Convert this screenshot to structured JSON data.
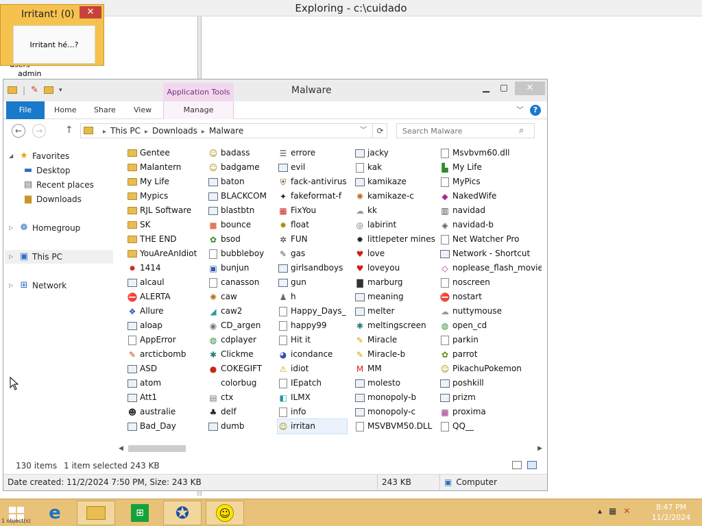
{
  "background_window": {
    "title": "Exploring - c:\\cuidado",
    "tree": [
      "users",
      "admin"
    ]
  },
  "irritant_popup": {
    "title": "Irritant! (0)",
    "close": "✕",
    "message": "Irritant hé...?"
  },
  "explorer": {
    "title": "Malware",
    "contextual_tab_group": "Application Tools",
    "ribbon_tabs": {
      "file": "File",
      "home": "Home",
      "share": "Share",
      "view": "View",
      "manage": "Manage"
    },
    "breadcrumb": [
      "This PC",
      "Downloads",
      "Malware"
    ],
    "search_placeholder": "Search Malware",
    "nav": {
      "favorites": "Favorites",
      "desktop": "Desktop",
      "recent": "Recent places",
      "downloads": "Downloads",
      "homegroup": "Homegroup",
      "this_pc": "This PC",
      "network": "Network"
    },
    "columns": [
      [
        {
          "name": "Gentee",
          "icon": "folder"
        },
        {
          "name": "Malantern",
          "icon": "folder"
        },
        {
          "name": "My Life",
          "icon": "folder"
        },
        {
          "name": "Mypics",
          "icon": "folder"
        },
        {
          "name": "RJL Software",
          "icon": "folder"
        },
        {
          "name": "SK",
          "icon": "folder"
        },
        {
          "name": "THE END",
          "icon": "folder"
        },
        {
          "name": "YouAreAnIdiot",
          "icon": "folder"
        },
        {
          "name": "1414",
          "icon": "glyph",
          "glyph": "✸",
          "color": "#c0261e"
        },
        {
          "name": "alcaul",
          "icon": "exe"
        },
        {
          "name": "ALERTA",
          "icon": "glyph",
          "glyph": "⛔",
          "color": "#d01b1b"
        },
        {
          "name": "Allure",
          "icon": "glyph",
          "glyph": "❖",
          "color": "#2b55b5"
        },
        {
          "name": "aloap",
          "icon": "exe"
        },
        {
          "name": "AppError",
          "icon": "doc"
        },
        {
          "name": "arcticbomb",
          "icon": "glyph",
          "glyph": "✎",
          "color": "#c4481a"
        },
        {
          "name": "ASD",
          "icon": "exe"
        },
        {
          "name": "atom",
          "icon": "exe"
        },
        {
          "name": "Att1",
          "icon": "exe"
        },
        {
          "name": "australie",
          "icon": "glyph",
          "glyph": "☻",
          "color": "#333"
        },
        {
          "name": "Bad_Day",
          "icon": "exe"
        }
      ],
      [
        {
          "name": "badass",
          "icon": "glyph",
          "glyph": "☺",
          "color": "#a88a00"
        },
        {
          "name": "badgame",
          "icon": "glyph",
          "glyph": "☺",
          "color": "#a88a00"
        },
        {
          "name": "baton",
          "icon": "exe"
        },
        {
          "name": "BLACKCOM",
          "icon": "exe"
        },
        {
          "name": "blastbtn",
          "icon": "exe"
        },
        {
          "name": "bounce",
          "icon": "glyph",
          "glyph": "■",
          "color": "#e47a5a"
        },
        {
          "name": "bsod",
          "icon": "glyph",
          "glyph": "✿",
          "color": "#2f8a2f"
        },
        {
          "name": "bubbleboy",
          "icon": "doc"
        },
        {
          "name": "bunjun",
          "icon": "glyph",
          "glyph": "▣",
          "color": "#3554a8"
        },
        {
          "name": "canasson",
          "icon": "doc"
        },
        {
          "name": "caw",
          "icon": "glyph",
          "glyph": "✺",
          "color": "#b86f1a"
        },
        {
          "name": "caw2",
          "icon": "glyph",
          "glyph": "◢",
          "color": "#2a9aa5"
        },
        {
          "name": "CD_argen",
          "icon": "glyph",
          "glyph": "◉",
          "color": "#777"
        },
        {
          "name": "cdplayer",
          "icon": "glyph",
          "glyph": "◍",
          "color": "#2f8a2f"
        },
        {
          "name": "Clickme",
          "icon": "glyph",
          "glyph": "✱",
          "color": "#2a7a7a"
        },
        {
          "name": "COKEGIFT",
          "icon": "glyph",
          "glyph": "●",
          "color": "#c4261e"
        },
        {
          "name": "colorbug",
          "icon": "none"
        },
        {
          "name": "ctx",
          "icon": "glyph",
          "glyph": "▤",
          "color": "#777"
        },
        {
          "name": "delf",
          "icon": "glyph",
          "glyph": "♣",
          "color": "#222"
        },
        {
          "name": "dumb",
          "icon": "exe"
        }
      ],
      [
        {
          "name": "errore",
          "icon": "glyph",
          "glyph": "☰",
          "color": "#555"
        },
        {
          "name": "evil",
          "icon": "exe"
        },
        {
          "name": "fack-antivirus",
          "icon": "glyph",
          "glyph": "⛨",
          "color": "#6b4a1a"
        },
        {
          "name": "fakeformat-f",
          "icon": "glyph",
          "glyph": "✦",
          "color": "#222"
        },
        {
          "name": "FixYou",
          "icon": "glyph",
          "glyph": "▦",
          "color": "#c4261e"
        },
        {
          "name": "float",
          "icon": "glyph",
          "glyph": "✹",
          "color": "#a88a00"
        },
        {
          "name": "FUN",
          "icon": "glyph",
          "glyph": "✲",
          "color": "#333"
        },
        {
          "name": "gas",
          "icon": "glyph",
          "glyph": "✎",
          "color": "#555"
        },
        {
          "name": "girlsandboys",
          "icon": "exe"
        },
        {
          "name": "gun",
          "icon": "exe"
        },
        {
          "name": "h",
          "icon": "glyph",
          "glyph": "♟",
          "color": "#666"
        },
        {
          "name": "Happy_Days_",
          "icon": "doc"
        },
        {
          "name": "happy99",
          "icon": "doc"
        },
        {
          "name": "Hit it",
          "icon": "doc"
        },
        {
          "name": "icondance",
          "icon": "glyph",
          "glyph": "◕",
          "color": "#3554a8"
        },
        {
          "name": "idiot",
          "icon": "glyph",
          "glyph": "⚠",
          "color": "#c9a400"
        },
        {
          "name": "IEpatch",
          "icon": "doc"
        },
        {
          "name": "ILMX",
          "icon": "glyph",
          "glyph": "◧",
          "color": "#2a9aa5"
        },
        {
          "name": "info",
          "icon": "doc"
        },
        {
          "name": "irritan",
          "icon": "glyph",
          "glyph": "☺",
          "color": "#a88a00",
          "selected": true
        }
      ],
      [
        {
          "name": "jacky",
          "icon": "exe"
        },
        {
          "name": "kak",
          "icon": "doc"
        },
        {
          "name": "kamikaze",
          "icon": "exe"
        },
        {
          "name": "kamikaze-c",
          "icon": "glyph",
          "glyph": "✺",
          "color": "#b86f1a"
        },
        {
          "name": "kk",
          "icon": "glyph",
          "glyph": "☁",
          "color": "#999"
        },
        {
          "name": "labirint",
          "icon": "glyph",
          "glyph": "◎",
          "color": "#666"
        },
        {
          "name": "littlepeter mines",
          "icon": "glyph",
          "glyph": "✸",
          "color": "#222"
        },
        {
          "name": "love",
          "icon": "glyph",
          "glyph": "♥",
          "color": "#d01b1b"
        },
        {
          "name": "loveyou",
          "icon": "glyph",
          "glyph": "♥",
          "color": "#d01b1b"
        },
        {
          "name": "marburg",
          "icon": "glyph",
          "glyph": "▇",
          "color": "#333"
        },
        {
          "name": "meaning",
          "icon": "exe"
        },
        {
          "name": "melter",
          "icon": "exe"
        },
        {
          "name": "meltingscreen",
          "icon": "glyph",
          "glyph": "✱",
          "color": "#2a7a7a"
        },
        {
          "name": "Miracle",
          "icon": "glyph",
          "glyph": "✎",
          "color": "#c9a400"
        },
        {
          "name": "Miracle-b",
          "icon": "glyph",
          "glyph": "✎",
          "color": "#c9a400"
        },
        {
          "name": "MM",
          "icon": "glyph",
          "glyph": "M",
          "color": "#d41b1b"
        },
        {
          "name": "molesto",
          "icon": "exe"
        },
        {
          "name": "monopoly-b",
          "icon": "exe"
        },
        {
          "name": "monopoly-c",
          "icon": "exe"
        },
        {
          "name": "MSVBVM50.DLL",
          "icon": "doc"
        }
      ],
      [
        {
          "name": "Msvbvm60.dll",
          "icon": "doc"
        },
        {
          "name": "My Life",
          "icon": "glyph",
          "glyph": "▙",
          "color": "#2f8a2f"
        },
        {
          "name": "MyPics",
          "icon": "doc"
        },
        {
          "name": "NakedWife",
          "icon": "glyph",
          "glyph": "◆",
          "color": "#a0308a"
        },
        {
          "name": "navidad",
          "icon": "glyph",
          "glyph": "▥",
          "color": "#444"
        },
        {
          "name": "navidad-b",
          "icon": "glyph",
          "glyph": "◈",
          "color": "#555"
        },
        {
          "name": "Net Watcher Pro",
          "icon": "doc"
        },
        {
          "name": "Network - Shortcut",
          "icon": "exe"
        },
        {
          "name": "noplease_flash_movie",
          "icon": "glyph",
          "glyph": "◇",
          "color": "#a0308a"
        },
        {
          "name": "noscreen",
          "icon": "doc"
        },
        {
          "name": "nostart",
          "icon": "glyph",
          "glyph": "⛔",
          "color": "#d01b1b"
        },
        {
          "name": "nuttymouse",
          "icon": "glyph",
          "glyph": "☁",
          "color": "#999"
        },
        {
          "name": "open_cd",
          "icon": "glyph",
          "glyph": "◍",
          "color": "#2f8a2f"
        },
        {
          "name": "parkin",
          "icon": "doc"
        },
        {
          "name": "parrot",
          "icon": "glyph",
          "glyph": "✿",
          "color": "#6a8a1a"
        },
        {
          "name": "PikachuPokemon",
          "icon": "glyph",
          "glyph": "☺",
          "color": "#a88a00"
        },
        {
          "name": "poshkill",
          "icon": "exe"
        },
        {
          "name": "prizm",
          "icon": "exe"
        },
        {
          "name": "proxima",
          "icon": "glyph",
          "glyph": "▦",
          "color": "#a0308a"
        },
        {
          "name": "QQ__",
          "icon": "doc"
        }
      ]
    ],
    "status": {
      "count": "130 items",
      "selected": "1 item selected  243 KB"
    },
    "infobar": {
      "date_size": "Date created: 11/2/2024 7:50 PM, Size: 243 KB",
      "size": "243 KB",
      "location": "Computer"
    }
  },
  "taskbar": {
    "start_label": "1 object(s)",
    "clock_time": "8:47 PM",
    "clock_date": "11/2/2024"
  },
  "colors": {
    "accent": "#1979ca",
    "taskbar": "#e9c27a",
    "popup": "#f6c24e",
    "close_red": "#c7423b"
  }
}
